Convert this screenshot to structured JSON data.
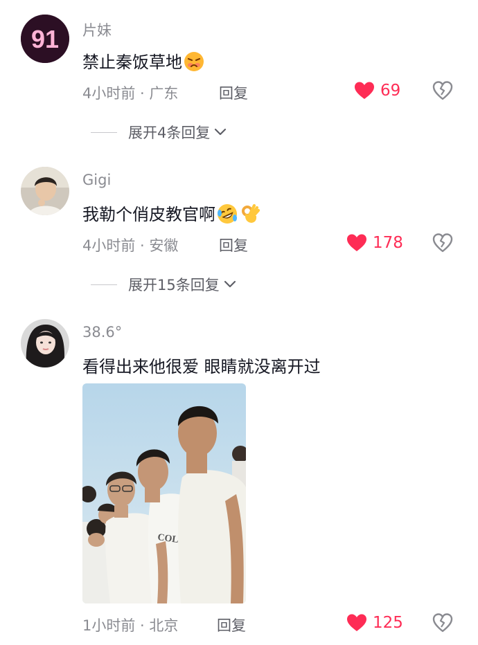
{
  "comments": [
    {
      "username": "片妹",
      "avatar_text": "91",
      "text": "禁止秦饭草地",
      "emojis": [
        "pouting-face-emoji"
      ],
      "time_location": "4小时前 · 广东",
      "reply_label": "回复",
      "likes": "69",
      "expand_label": "展开4条回复"
    },
    {
      "username": "Gigi",
      "text": "我勒个俏皮教官啊",
      "emojis": [
        "rolling-laughing-emoji",
        "ok-hand-emoji"
      ],
      "time_location": "4小时前 · 安徽",
      "reply_label": "回复",
      "likes": "178",
      "expand_label": "展开15条回复"
    },
    {
      "username": "38.6°",
      "text": "看得出来他很爱 眼睛就没离开过",
      "time_location": "1小时前 · 北京",
      "reply_label": "回复",
      "likes": "125",
      "has_photo": true
    }
  ],
  "colors": {
    "like_red": "#fe2c55",
    "meta_gray": "#8a8b91",
    "text_dark": "#161823",
    "avatar1_bg": "#3a1630",
    "avatar1_text": "#ff9ec8"
  },
  "icons": [
    "heart-icon",
    "broken-heart-icon",
    "chevron-down-icon"
  ]
}
